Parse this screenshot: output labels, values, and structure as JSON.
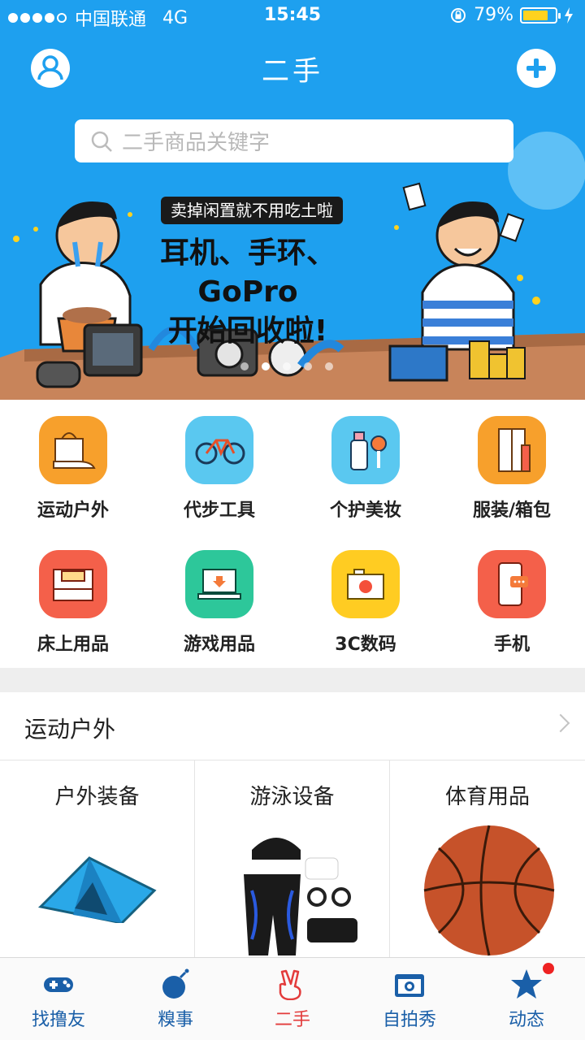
{
  "status_bar": {
    "carrier": "中国联通",
    "network": "4G",
    "time": "15:45",
    "battery": "79%",
    "battery_level": 0.79
  },
  "header": {
    "title": "二手"
  },
  "search": {
    "placeholder": "二手商品关键字"
  },
  "banner": {
    "tag": "卖掉闲置就不用吃土啦",
    "headline_line1": "耳机、手环、GoPro",
    "headline_line2": "开始回收啦!",
    "active_slide": 1,
    "slide_count": 5
  },
  "categories": [
    {
      "label": "运动户外",
      "icon": "shoe-bag-icon",
      "color": "#f7a02c"
    },
    {
      "label": "代步工具",
      "icon": "bicycle-icon",
      "color": "#5ac8f0"
    },
    {
      "label": "个护美妆",
      "icon": "bottle-icon",
      "color": "#5ac8f0"
    },
    {
      "label": "服装/箱包",
      "icon": "wardrobe-icon",
      "color": "#f7a02c"
    },
    {
      "label": "床上用品",
      "icon": "bed-icon",
      "color": "#f4604a"
    },
    {
      "label": "游戏用品",
      "icon": "laptop-icon",
      "color": "#2dc79a"
    },
    {
      "label": "3C数码",
      "icon": "camera-icon",
      "color": "#ffcc22"
    },
    {
      "label": "手机",
      "icon": "phone-icon",
      "color": "#f4604a"
    }
  ],
  "section": {
    "title": "运动户外"
  },
  "products": [
    {
      "name": "户外装备"
    },
    {
      "name": "游泳设备"
    },
    {
      "name": "体育用品"
    }
  ],
  "tabs": [
    {
      "label": "找撸友",
      "icon": "gamepad-icon"
    },
    {
      "label": "糗事",
      "icon": "bomb-icon"
    },
    {
      "label": "二手",
      "icon": "hand-icon",
      "active": true
    },
    {
      "label": "自拍秀",
      "icon": "camera-icon"
    },
    {
      "label": "动态",
      "icon": "star-icon",
      "has_badge": true
    }
  ],
  "colors": {
    "primary_blue": "#1ea0ef",
    "active_red": "#e33b3b",
    "tab_blue": "#1a5fa8"
  }
}
